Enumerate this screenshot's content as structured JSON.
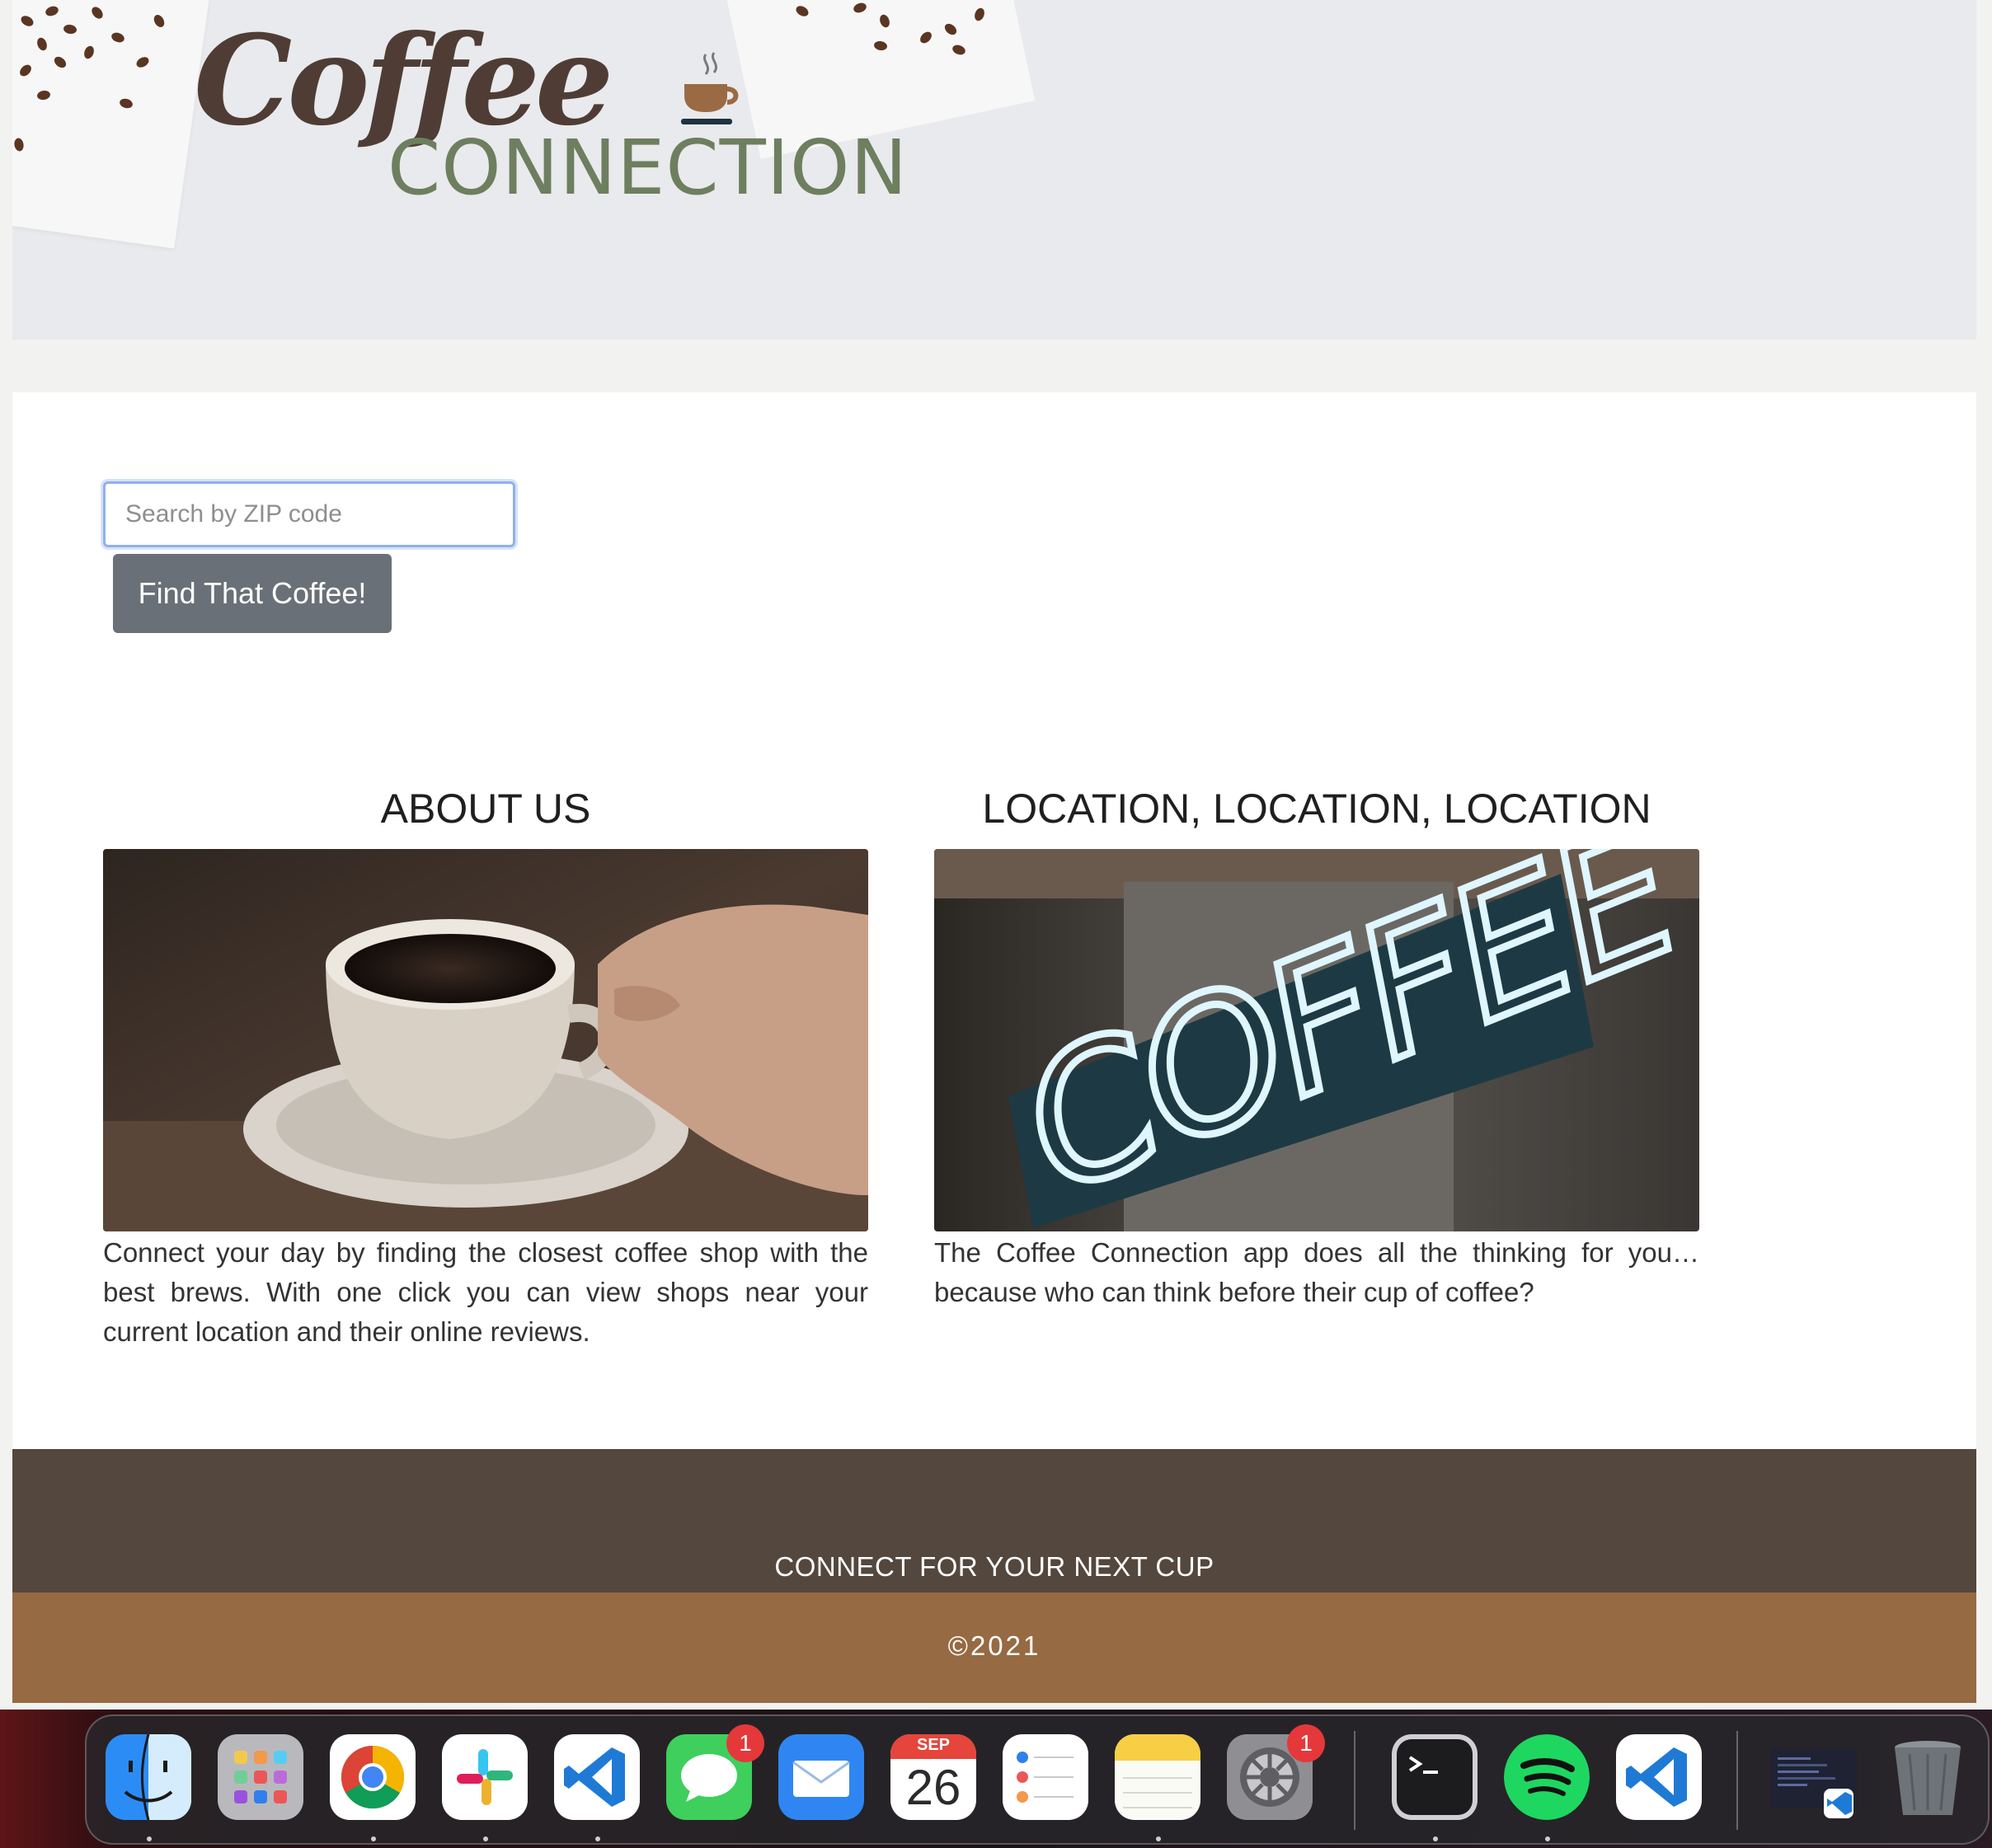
{
  "header": {
    "logo_word_1": "Coffee",
    "logo_word_2": "CONNECTION"
  },
  "search": {
    "placeholder": "Search by ZIP code",
    "value": "",
    "button_label": "Find That Coffee!"
  },
  "sections": [
    {
      "heading": "ABOUT US",
      "image": "coffee-cup-photo",
      "text": "Connect your day by finding the closest coffee shop with the best brews. With one click you can view shops near your current location and their online reviews."
    },
    {
      "heading": "LOCATION, LOCATION, LOCATION",
      "image": "neon-coffee-sign-photo",
      "sign_text": "COFFEE",
      "text": "The Coffee Connection app does all the thinking for you… because who can think before their cup of coffee?"
    }
  ],
  "footer": {
    "tagline": "CONNECT FOR YOUR NEXT CUP",
    "copyright": "©2021"
  },
  "dock": {
    "apps": [
      {
        "name": "Finder",
        "icon": "finder-icon"
      },
      {
        "name": "Launchpad",
        "icon": "launchpad-icon"
      },
      {
        "name": "Chrome",
        "icon": "chrome-icon"
      },
      {
        "name": "Slack",
        "icon": "slack-icon"
      },
      {
        "name": "VS Code",
        "icon": "vscode-icon"
      },
      {
        "name": "Messages",
        "icon": "messages-icon",
        "badge": "1"
      },
      {
        "name": "Mail",
        "icon": "mail-icon"
      },
      {
        "name": "Calendar",
        "icon": "calendar-icon",
        "month": "SEP",
        "day": "26"
      },
      {
        "name": "Reminders",
        "icon": "reminders-icon"
      },
      {
        "name": "Notes",
        "icon": "notes-icon"
      },
      {
        "name": "System Preferences",
        "icon": "settings-icon",
        "badge": "1"
      },
      {
        "name": "Terminal",
        "icon": "terminal-icon"
      },
      {
        "name": "Spotify",
        "icon": "spotify-icon"
      },
      {
        "name": "VS Code",
        "icon": "vscode-icon"
      },
      {
        "name": "Window Preview",
        "icon": "window-thumbnail-icon"
      },
      {
        "name": "Trash",
        "icon": "trash-icon"
      }
    ]
  },
  "colors": {
    "header_bg": "#e9eaed",
    "logo_brown": "#4f3d35",
    "logo_green": "#6d7f5f",
    "button_gray": "#6a7077",
    "footer_dark": "#54473e",
    "footer_tan": "#966a42"
  }
}
